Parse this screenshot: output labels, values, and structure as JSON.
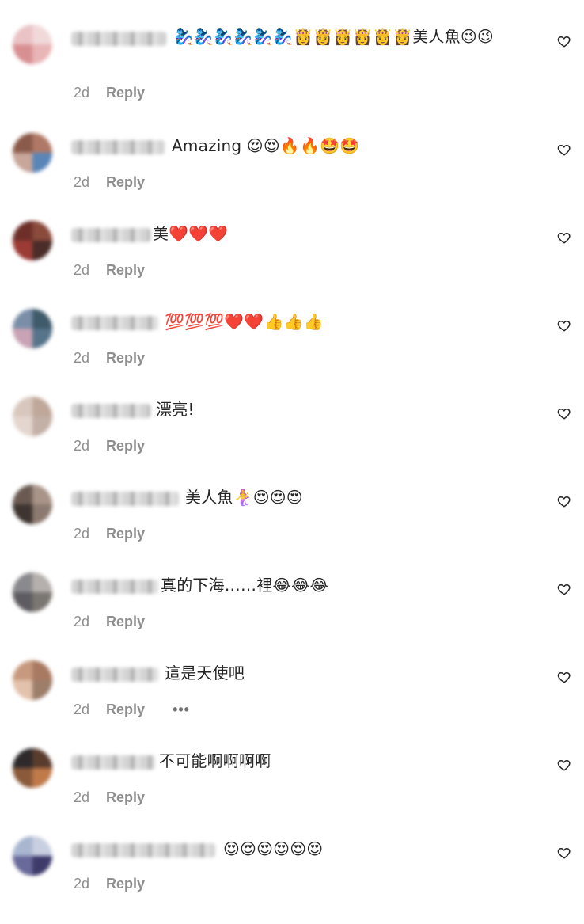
{
  "comments": [
    {
      "text": "🧞‍♀️🧞‍♀️🧞‍♀️🧞‍♀️🧞‍♀️🧞‍♀️👸👸👸👸👸👸美人魚😉😉",
      "age": "2d",
      "reply": "Reply"
    },
    {
      "text": "Amazing 😍😍🔥🔥🤩🤩",
      "age": "2d",
      "reply": "Reply"
    },
    {
      "text": "美❤️❤️❤️",
      "age": "2d",
      "reply": "Reply"
    },
    {
      "text": "💯💯💯❤️❤️👍👍👍",
      "age": "2d",
      "reply": "Reply"
    },
    {
      "text": "漂亮!",
      "age": "2d",
      "reply": "Reply"
    },
    {
      "text": "美人魚🧜‍♀️😍😍😍",
      "age": "2d",
      "reply": "Reply"
    },
    {
      "text": "真的下海……裡😂😂😂",
      "age": "2d",
      "reply": "Reply"
    },
    {
      "text": "這是天使吧",
      "age": "2d",
      "reply": "Reply",
      "more": "•••"
    },
    {
      "text": "不可能啊啊啊啊",
      "age": "2d",
      "reply": "Reply"
    },
    {
      "text": "😍😍😍😍😍😍",
      "age": "2d",
      "reply": "Reply"
    }
  ],
  "icons": {
    "like": "heart-outline-icon"
  },
  "colors": {
    "text": "#262626",
    "secondary": "#8e8e8e",
    "background": "#ffffff"
  }
}
